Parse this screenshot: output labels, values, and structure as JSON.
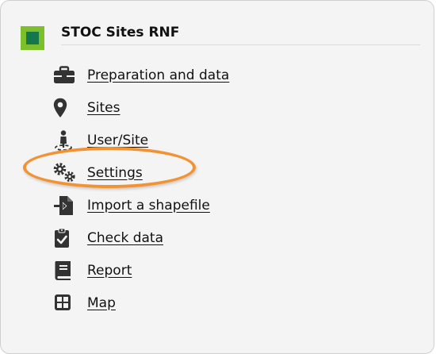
{
  "header": {
    "title": "STOC Sites RNF",
    "logo_colors": {
      "outer": "#7cbf2a",
      "inner": "#14784a"
    }
  },
  "menu": {
    "items": [
      {
        "label": "Preparation and data",
        "icon": "toolbox-icon"
      },
      {
        "label": "Sites",
        "icon": "map-marker-icon"
      },
      {
        "label": "User/Site",
        "icon": "user-location-icon"
      },
      {
        "label": "Settings",
        "icon": "gears-icon"
      },
      {
        "label": "Import a shapefile",
        "icon": "file-import-icon"
      },
      {
        "label": "Check data",
        "icon": "clipboard-check-icon"
      },
      {
        "label": "Report",
        "icon": "book-icon"
      },
      {
        "label": "Map",
        "icon": "grid-map-icon"
      }
    ]
  },
  "annotation": {
    "highlighted_item": "Settings",
    "color": "#f29233"
  }
}
